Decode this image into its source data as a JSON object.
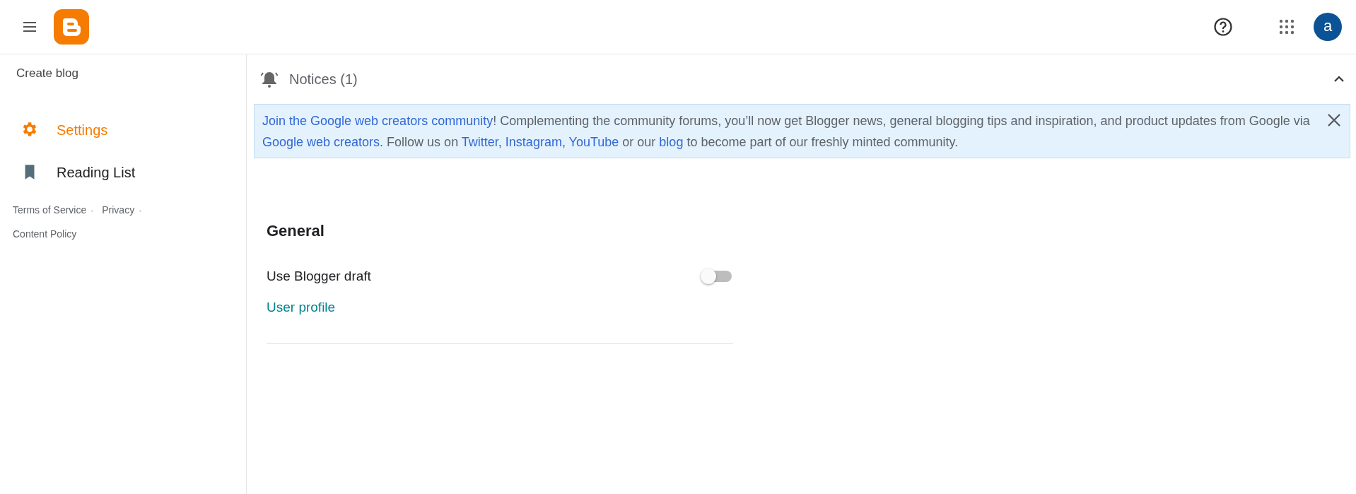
{
  "header": {
    "avatar_letter": "a"
  },
  "sidebar": {
    "create_label": "Create blog",
    "items": [
      {
        "label": "Settings",
        "kind": "settings",
        "selected": true
      },
      {
        "label": "Reading List",
        "kind": "bookmark",
        "selected": false
      }
    ],
    "footer": [
      {
        "kind": "link",
        "text": "Terms of Service"
      },
      {
        "kind": "separator",
        "text": "·"
      },
      {
        "kind": "link",
        "text": "Privacy"
      },
      {
        "kind": "separator",
        "text": "·"
      },
      {
        "kind": "link",
        "text": "Content Policy"
      }
    ]
  },
  "notices": {
    "title": "Notices (1)",
    "expanded": true,
    "message": [
      {
        "kind": "link",
        "text": "Join the Google web creators community"
      },
      {
        "kind": "text",
        "text": "! Complementing the community forums, you’ll now get Blogger news, general blogging tips and inspiration, and product updates from Google via "
      },
      {
        "kind": "link",
        "text": "Google web creators"
      },
      {
        "kind": "text",
        "text": ". Follow us on "
      },
      {
        "kind": "link",
        "text": "Twitter"
      },
      {
        "kind": "text",
        "text": ", "
      },
      {
        "kind": "link",
        "text": "Instagram"
      },
      {
        "kind": "text",
        "text": ", "
      },
      {
        "kind": "link",
        "text": "YouTube"
      },
      {
        "kind": "text",
        "text": " or our "
      },
      {
        "kind": "link",
        "text": "blog"
      },
      {
        "kind": "text",
        "text": " to become part of our freshly minted community."
      }
    ]
  },
  "general": {
    "heading": "General",
    "settings": [
      {
        "kind": "toggle",
        "label": "Use Blogger draft",
        "on": false
      },
      {
        "kind": "link",
        "label": "User profile"
      }
    ]
  }
}
